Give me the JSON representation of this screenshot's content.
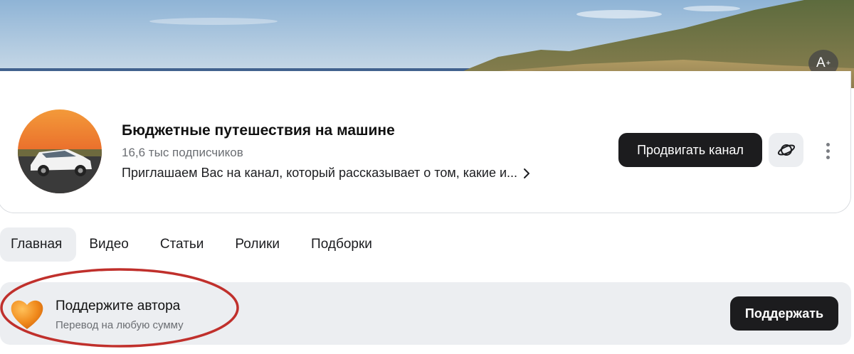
{
  "cover": {
    "accessibility_button_label": "A",
    "accessibility_button_sup": "+",
    "icon": "a-plus-icon"
  },
  "channel": {
    "title": "Бюджетные путешествия на машине",
    "subscribers": "16,6 тыс подписчиков",
    "description": "Приглашаем Вас на канал, который рассказывает о том, какие и...",
    "promote_label": "Продвигать канал",
    "planet_icon": "planet-icon",
    "more_icon": "more-vertical-icon"
  },
  "tabs": [
    {
      "label": "Главная",
      "active": true
    },
    {
      "label": "Видео",
      "active": false
    },
    {
      "label": "Статьи",
      "active": false
    },
    {
      "label": "Ролики",
      "active": false
    },
    {
      "label": "Подборки",
      "active": false
    }
  ],
  "support": {
    "title": "Поддержите автора",
    "subtitle": "Перевод на любую сумму",
    "button_label": "Поддержать",
    "icon": "heart-icon"
  },
  "colors": {
    "dark_button": "#1c1c1e",
    "light_surface": "#eceef1",
    "annotation": "#c0302c",
    "heart": "#f08a1c"
  }
}
